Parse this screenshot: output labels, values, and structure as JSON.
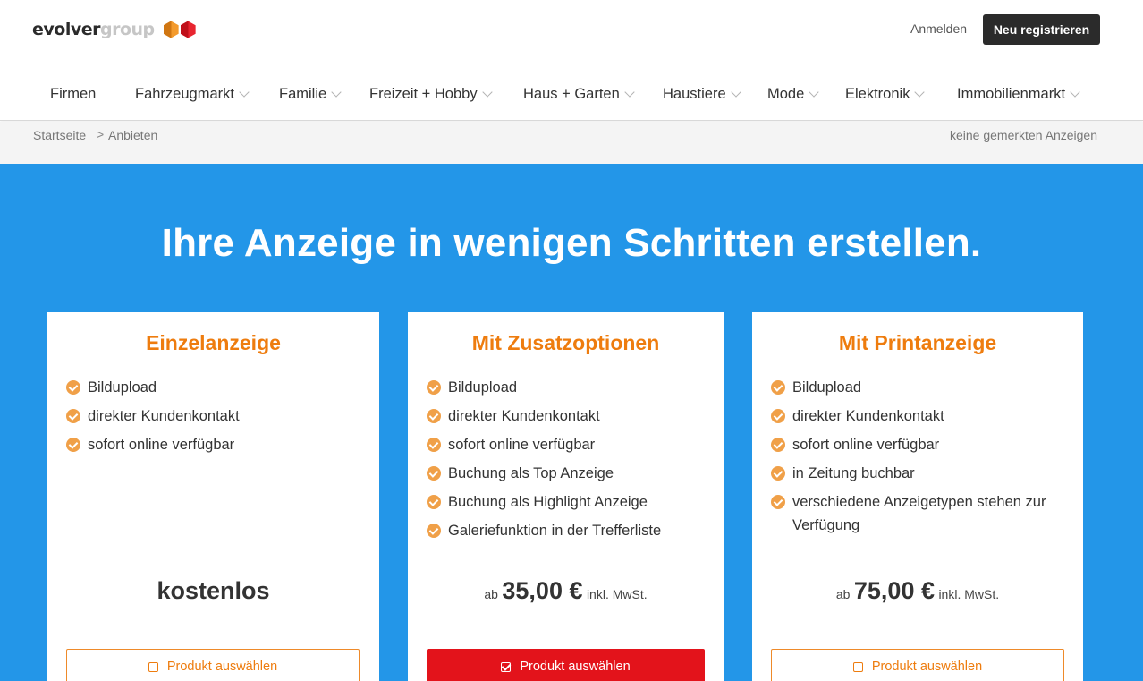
{
  "header": {
    "logo_part1": "evolver",
    "logo_part2": "group",
    "login_label": "Anmelden",
    "register_label": "Neu registrieren"
  },
  "nav": {
    "items": [
      {
        "label": "Firmen"
      },
      {
        "label": "Fahrzeugmarkt"
      },
      {
        "label": "Familie"
      },
      {
        "label": "Freizeit + Hobby"
      },
      {
        "label": "Haus + Garten"
      },
      {
        "label": "Haustiere"
      },
      {
        "label": "Mode"
      },
      {
        "label": "Elektronik"
      },
      {
        "label": "Immobilienmarkt"
      }
    ]
  },
  "breadcrumb": {
    "items": [
      "Startseite",
      "Anbieten"
    ],
    "separator": ">",
    "saved_ads": "keine gemerkten Anzeigen"
  },
  "hero": {
    "title": "Ihre Anzeige in wenigen Schritten erstellen."
  },
  "plans": [
    {
      "title": "Einzelanzeige",
      "features": [
        "Bildupload",
        "direkter Kundenkontakt",
        "sofort online verfügbar"
      ],
      "price_free": "kostenlos",
      "button_label": "Produkt auswählen",
      "selected": false
    },
    {
      "title": "Mit Zusatzoptionen",
      "features": [
        "Bildupload",
        "direkter Kundenkontakt",
        "sofort online verfügbar",
        "Buchung als Top Anzeige",
        "Buchung als Highlight Anzeige",
        "Galeriefunktion in der Trefferliste"
      ],
      "price_prefix": "ab",
      "price_value": "35,00 €",
      "price_suffix": "inkl. MwSt.",
      "button_label": "Produkt auswählen",
      "selected": true
    },
    {
      "title": "Mit Printanzeige",
      "features": [
        "Bildupload",
        "direkter Kundenkontakt",
        "sofort online verfügbar",
        "in Zeitung buchbar",
        "verschiedene Anzeigetypen stehen zur Verfügung"
      ],
      "price_prefix": "ab",
      "price_value": "75,00 €",
      "price_suffix": "inkl. MwSt.",
      "button_label": "Produkt auswählen",
      "selected": false
    }
  ],
  "colors": {
    "hero_bg": "#2396e8",
    "accent_orange": "#ee7c0e",
    "selected_red": "#e3131b",
    "dark_button": "#2b2b2b"
  }
}
